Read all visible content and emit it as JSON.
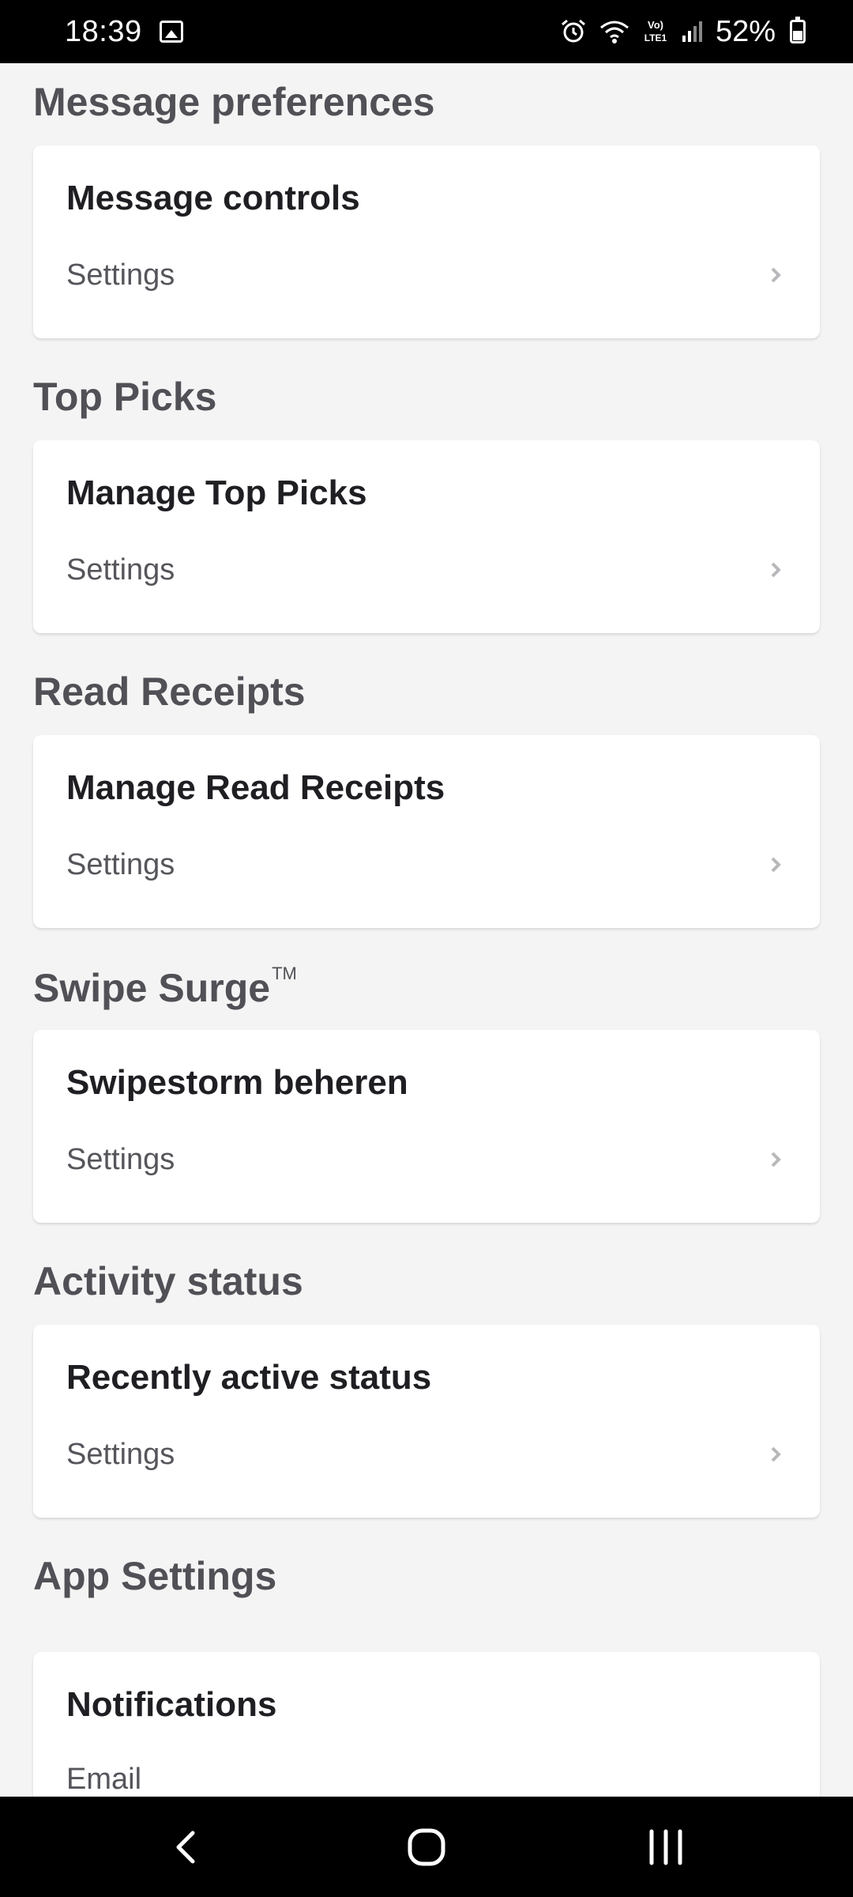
{
  "status_bar": {
    "time": "18:39",
    "battery_text": "52%",
    "icons": [
      "gallery-icon",
      "alarm-icon",
      "wifi-icon",
      "volte-icon",
      "signal-icon",
      "battery-icon"
    ],
    "volte_label": "Vo) LTE1"
  },
  "sections": [
    {
      "title": "Message preferences",
      "card_title": "Message controls",
      "card_sub": "Settings"
    },
    {
      "title": "Top Picks",
      "card_title": "Manage Top Picks",
      "card_sub": "Settings"
    },
    {
      "title": "Read Receipts",
      "card_title": "Manage Read Receipts",
      "card_sub": "Settings"
    },
    {
      "title": "Swipe Surge",
      "title_mark": "TM",
      "card_title": "Swipestorm beheren",
      "card_sub": "Settings"
    },
    {
      "title": "Activity status",
      "card_title": "Recently active status",
      "card_sub": "Settings"
    },
    {
      "title": "App Settings",
      "card_title": "Notifications",
      "card_sub": "Email"
    }
  ],
  "nav_bar": {
    "buttons": [
      "back-icon",
      "home-icon",
      "recents-icon"
    ]
  },
  "colors": {
    "background": "#f4f4f4",
    "card": "#ffffff",
    "section_title": "#505056",
    "card_title": "#1f1f23",
    "card_sub": "#55555b",
    "chevron": "#b8b8bc"
  }
}
